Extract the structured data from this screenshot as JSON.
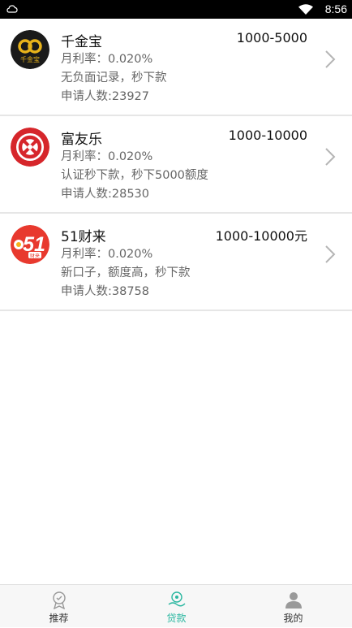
{
  "status_bar": {
    "time": "8:56",
    "left_icon": "notification-cloud-icon",
    "wifi_icon": "wifi-icon"
  },
  "loans": [
    {
      "name": "千金宝",
      "amount": "1000-5000",
      "rate": "月利率：0.020%",
      "desc": "无负面记录，秒下款",
      "applicants": "申请人数:23927",
      "logo_icon": "qianjinbao-logo-icon",
      "logo_text": "千金宝",
      "logo_color": "#1a1a1a"
    },
    {
      "name": "富友乐",
      "amount": "1000-10000",
      "rate": "月利率：0.020%",
      "desc": "认证秒下款，秒下5000额度",
      "applicants": "申请人数:28530",
      "logo_icon": "fuyoule-logo-icon",
      "logo_color": "#d6262b"
    },
    {
      "name": "51财来",
      "amount": "1000-10000元",
      "rate": "月利率：0.020%",
      "desc": "新口子，额度高，秒下款",
      "applicants": "申请人数:38758",
      "logo_icon": "51cailai-logo-icon",
      "logo_text": "51",
      "logo_sub": "财来",
      "logo_color": "#e8392e"
    }
  ],
  "tabs": [
    {
      "label": "推荐",
      "icon": "recommend-icon",
      "active": false
    },
    {
      "label": "贷款",
      "icon": "loan-icon",
      "active": true
    },
    {
      "label": "我的",
      "icon": "profile-icon",
      "active": false
    }
  ],
  "colors": {
    "accent": "#2ab7a0",
    "divider": "#e6e6e6"
  }
}
